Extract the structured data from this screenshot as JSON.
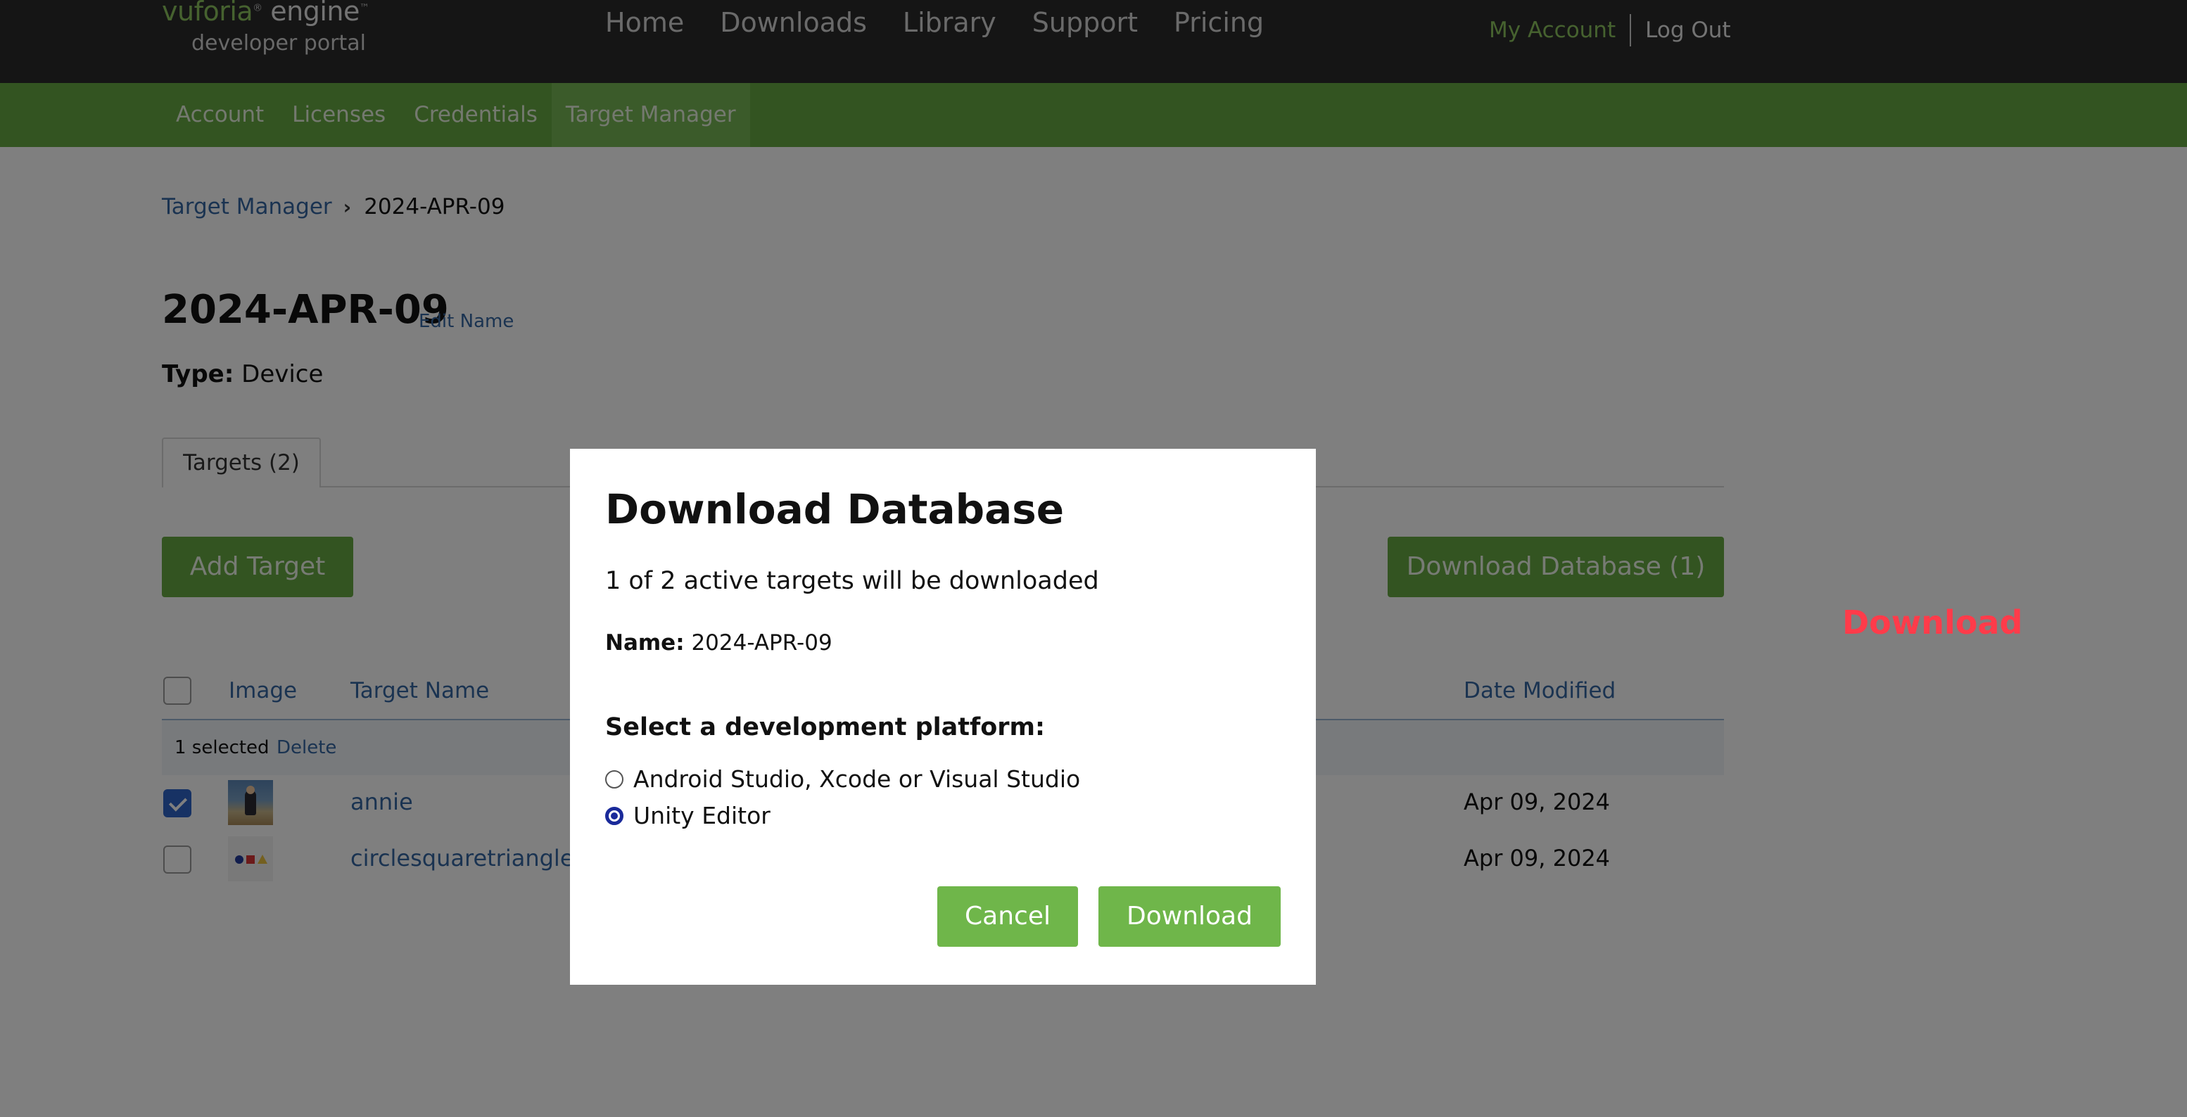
{
  "header": {
    "brand_logo_name": "vuforia",
    "brand_logo_product": "engine",
    "brand_sub": "developer portal",
    "nav": [
      "Home",
      "Downloads",
      "Library",
      "Support",
      "Pricing"
    ],
    "my_account": "My Account",
    "log_out": "Log Out"
  },
  "subnav": {
    "items": [
      "Account",
      "Licenses",
      "Credentials",
      "Target Manager"
    ],
    "active_index": 3
  },
  "breadcrumb": {
    "parent": "Target Manager",
    "current": "2024-APR-09"
  },
  "database": {
    "title": "2024-APR-09",
    "edit_name": "Edit Name",
    "type_label": "Type:",
    "type_value": "Device"
  },
  "tabs": {
    "targets": "Targets (2)"
  },
  "actions": {
    "add_target": "Add Target",
    "download_database": "Download Database (1)"
  },
  "floating_label": "Download",
  "table": {
    "headers": {
      "image": "Image",
      "target_name": "Target Name",
      "date_modified": "Date Modified"
    },
    "selection": {
      "count": "1 selected",
      "delete": "Delete"
    },
    "rows": [
      {
        "name": "annie",
        "date": "Apr 09, 2024",
        "checked": true
      },
      {
        "name": "circlesquaretriangle",
        "date": "Apr 09, 2024",
        "checked": false
      }
    ]
  },
  "modal": {
    "title": "Download Database",
    "message": "1 of 2 active targets will be downloaded",
    "name_label": "Name:",
    "name_value": "2024-APR-09",
    "select_label": "Select a development platform:",
    "options": [
      {
        "label": "Android Studio, Xcode or Visual Studio",
        "selected": false
      },
      {
        "label": "Unity Editor",
        "selected": true
      }
    ],
    "cancel": "Cancel",
    "download": "Download"
  },
  "colors": {
    "topbar": "#2b2b2b",
    "subnav": "#66a843",
    "link": "#3566a3",
    "accent_green": "#8dc45f",
    "button_green": "#6fb64a",
    "floating_label_red": "#ff3b4a"
  }
}
